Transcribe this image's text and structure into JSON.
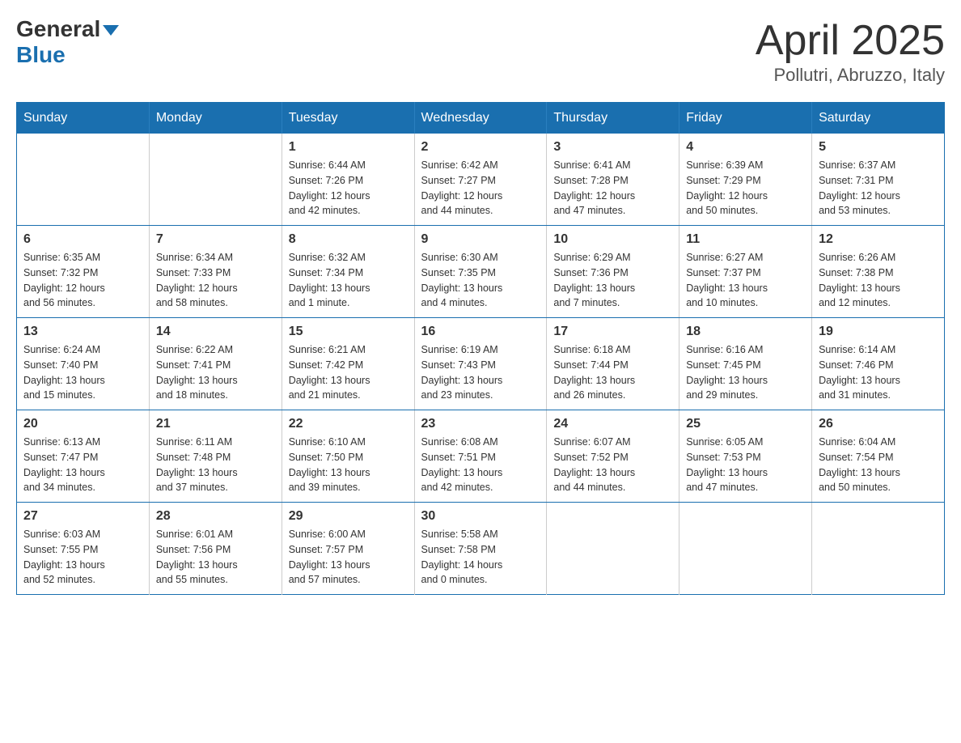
{
  "header": {
    "logo_line1": "General",
    "logo_line2": "Blue",
    "title": "April 2025",
    "subtitle": "Pollutri, Abruzzo, Italy"
  },
  "days_of_week": [
    "Sunday",
    "Monday",
    "Tuesday",
    "Wednesday",
    "Thursday",
    "Friday",
    "Saturday"
  ],
  "weeks": [
    [
      {
        "day": "",
        "sunrise": "",
        "sunset": "",
        "daylight": ""
      },
      {
        "day": "",
        "sunrise": "",
        "sunset": "",
        "daylight": ""
      },
      {
        "day": "1",
        "sunrise": "Sunrise: 6:44 AM",
        "sunset": "Sunset: 7:26 PM",
        "daylight": "Daylight: 12 hours and 42 minutes."
      },
      {
        "day": "2",
        "sunrise": "Sunrise: 6:42 AM",
        "sunset": "Sunset: 7:27 PM",
        "daylight": "Daylight: 12 hours and 44 minutes."
      },
      {
        "day": "3",
        "sunrise": "Sunrise: 6:41 AM",
        "sunset": "Sunset: 7:28 PM",
        "daylight": "Daylight: 12 hours and 47 minutes."
      },
      {
        "day": "4",
        "sunrise": "Sunrise: 6:39 AM",
        "sunset": "Sunset: 7:29 PM",
        "daylight": "Daylight: 12 hours and 50 minutes."
      },
      {
        "day": "5",
        "sunrise": "Sunrise: 6:37 AM",
        "sunset": "Sunset: 7:31 PM",
        "daylight": "Daylight: 12 hours and 53 minutes."
      }
    ],
    [
      {
        "day": "6",
        "sunrise": "Sunrise: 6:35 AM",
        "sunset": "Sunset: 7:32 PM",
        "daylight": "Daylight: 12 hours and 56 minutes."
      },
      {
        "day": "7",
        "sunrise": "Sunrise: 6:34 AM",
        "sunset": "Sunset: 7:33 PM",
        "daylight": "Daylight: 12 hours and 58 minutes."
      },
      {
        "day": "8",
        "sunrise": "Sunrise: 6:32 AM",
        "sunset": "Sunset: 7:34 PM",
        "daylight": "Daylight: 13 hours and 1 minute."
      },
      {
        "day": "9",
        "sunrise": "Sunrise: 6:30 AM",
        "sunset": "Sunset: 7:35 PM",
        "daylight": "Daylight: 13 hours and 4 minutes."
      },
      {
        "day": "10",
        "sunrise": "Sunrise: 6:29 AM",
        "sunset": "Sunset: 7:36 PM",
        "daylight": "Daylight: 13 hours and 7 minutes."
      },
      {
        "day": "11",
        "sunrise": "Sunrise: 6:27 AM",
        "sunset": "Sunset: 7:37 PM",
        "daylight": "Daylight: 13 hours and 10 minutes."
      },
      {
        "day": "12",
        "sunrise": "Sunrise: 6:26 AM",
        "sunset": "Sunset: 7:38 PM",
        "daylight": "Daylight: 13 hours and 12 minutes."
      }
    ],
    [
      {
        "day": "13",
        "sunrise": "Sunrise: 6:24 AM",
        "sunset": "Sunset: 7:40 PM",
        "daylight": "Daylight: 13 hours and 15 minutes."
      },
      {
        "day": "14",
        "sunrise": "Sunrise: 6:22 AM",
        "sunset": "Sunset: 7:41 PM",
        "daylight": "Daylight: 13 hours and 18 minutes."
      },
      {
        "day": "15",
        "sunrise": "Sunrise: 6:21 AM",
        "sunset": "Sunset: 7:42 PM",
        "daylight": "Daylight: 13 hours and 21 minutes."
      },
      {
        "day": "16",
        "sunrise": "Sunrise: 6:19 AM",
        "sunset": "Sunset: 7:43 PM",
        "daylight": "Daylight: 13 hours and 23 minutes."
      },
      {
        "day": "17",
        "sunrise": "Sunrise: 6:18 AM",
        "sunset": "Sunset: 7:44 PM",
        "daylight": "Daylight: 13 hours and 26 minutes."
      },
      {
        "day": "18",
        "sunrise": "Sunrise: 6:16 AM",
        "sunset": "Sunset: 7:45 PM",
        "daylight": "Daylight: 13 hours and 29 minutes."
      },
      {
        "day": "19",
        "sunrise": "Sunrise: 6:14 AM",
        "sunset": "Sunset: 7:46 PM",
        "daylight": "Daylight: 13 hours and 31 minutes."
      }
    ],
    [
      {
        "day": "20",
        "sunrise": "Sunrise: 6:13 AM",
        "sunset": "Sunset: 7:47 PM",
        "daylight": "Daylight: 13 hours and 34 minutes."
      },
      {
        "day": "21",
        "sunrise": "Sunrise: 6:11 AM",
        "sunset": "Sunset: 7:48 PM",
        "daylight": "Daylight: 13 hours and 37 minutes."
      },
      {
        "day": "22",
        "sunrise": "Sunrise: 6:10 AM",
        "sunset": "Sunset: 7:50 PM",
        "daylight": "Daylight: 13 hours and 39 minutes."
      },
      {
        "day": "23",
        "sunrise": "Sunrise: 6:08 AM",
        "sunset": "Sunset: 7:51 PM",
        "daylight": "Daylight: 13 hours and 42 minutes."
      },
      {
        "day": "24",
        "sunrise": "Sunrise: 6:07 AM",
        "sunset": "Sunset: 7:52 PM",
        "daylight": "Daylight: 13 hours and 44 minutes."
      },
      {
        "day": "25",
        "sunrise": "Sunrise: 6:05 AM",
        "sunset": "Sunset: 7:53 PM",
        "daylight": "Daylight: 13 hours and 47 minutes."
      },
      {
        "day": "26",
        "sunrise": "Sunrise: 6:04 AM",
        "sunset": "Sunset: 7:54 PM",
        "daylight": "Daylight: 13 hours and 50 minutes."
      }
    ],
    [
      {
        "day": "27",
        "sunrise": "Sunrise: 6:03 AM",
        "sunset": "Sunset: 7:55 PM",
        "daylight": "Daylight: 13 hours and 52 minutes."
      },
      {
        "day": "28",
        "sunrise": "Sunrise: 6:01 AM",
        "sunset": "Sunset: 7:56 PM",
        "daylight": "Daylight: 13 hours and 55 minutes."
      },
      {
        "day": "29",
        "sunrise": "Sunrise: 6:00 AM",
        "sunset": "Sunset: 7:57 PM",
        "daylight": "Daylight: 13 hours and 57 minutes."
      },
      {
        "day": "30",
        "sunrise": "Sunrise: 5:58 AM",
        "sunset": "Sunset: 7:58 PM",
        "daylight": "Daylight: 14 hours and 0 minutes."
      },
      {
        "day": "",
        "sunrise": "",
        "sunset": "",
        "daylight": ""
      },
      {
        "day": "",
        "sunrise": "",
        "sunset": "",
        "daylight": ""
      },
      {
        "day": "",
        "sunrise": "",
        "sunset": "",
        "daylight": ""
      }
    ]
  ]
}
